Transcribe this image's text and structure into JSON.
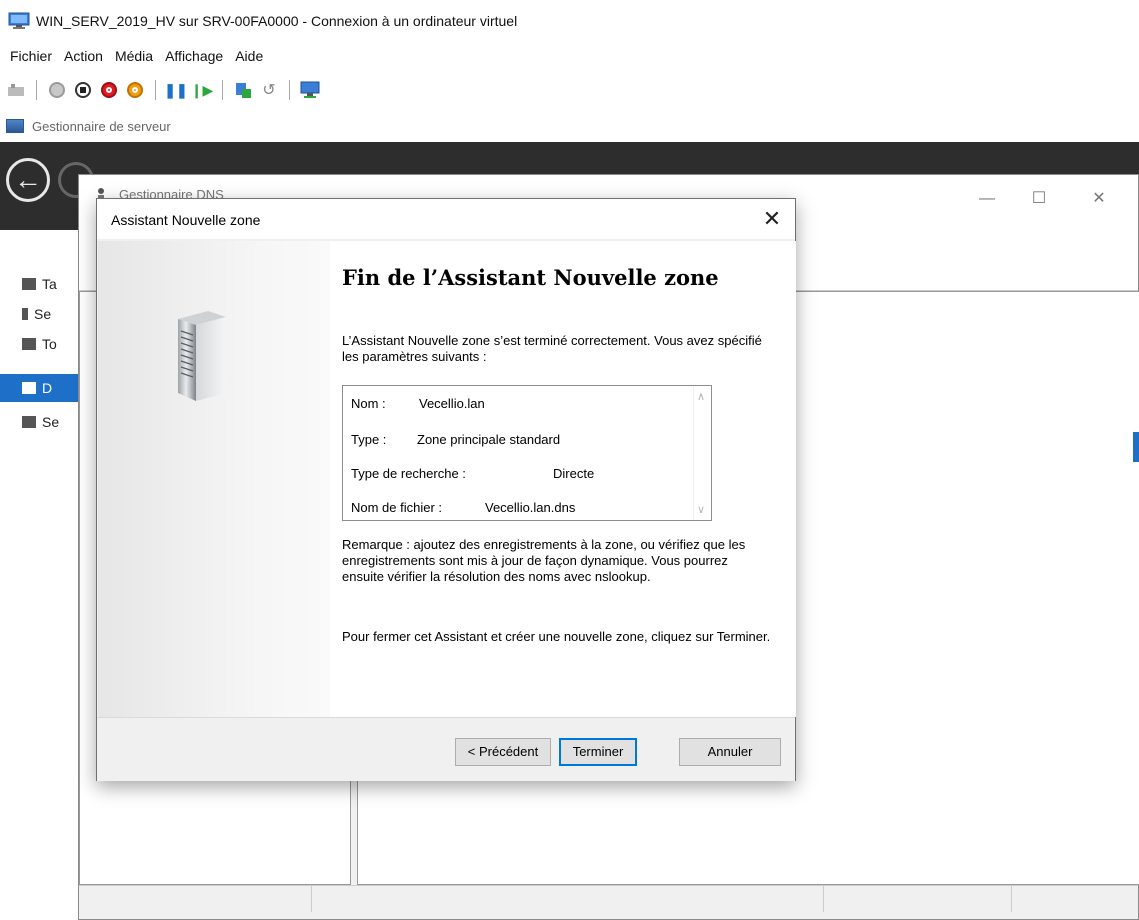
{
  "vm_window": {
    "title": "WIN_SERV_2019_HV sur SRV-00FA0000 - Connexion à un ordinateur virtuel",
    "menu": [
      "Fichier",
      "Action",
      "Média",
      "Affichage",
      "Aide"
    ]
  },
  "server_manager": {
    "tab_label": "Gestionnaire de serveur",
    "sidebar_items": [
      {
        "label": "Ta",
        "icon": "dashboard-icon",
        "active": false
      },
      {
        "label": "Se",
        "icon": "server-icon",
        "active": false
      },
      {
        "label": "To",
        "icon": "all-servers-icon",
        "active": false
      },
      {
        "label": "D",
        "icon": "dns-icon",
        "active": true
      },
      {
        "label": "Se",
        "icon": "file-services-icon",
        "active": false
      }
    ],
    "accent": "#1e6fc8"
  },
  "dns_window": {
    "title": "Gestionnaire DNS"
  },
  "wizard": {
    "title": "Assistant Nouvelle zone",
    "heading": "Fin de l’Assistant Nouvelle zone",
    "intro": "L’Assistant Nouvelle zone s’est terminé correctement. Vous avez spécifié les paramètres suivants :",
    "summary": {
      "name_label": "Nom :",
      "name_value": "Vecellio.lan",
      "type_label": "Type :",
      "type_value": "Zone principale standard",
      "lookup_label": "Type de recherche :",
      "lookup_value": "Directe",
      "file_label": "Nom de fichier :",
      "file_value": "Vecellio.lan.dns"
    },
    "note": "Remarque : ajoutez des enregistrements à la zone, ou vérifiez que les enregistrements sont mis à jour de façon dynamique. Vous pourrez ensuite vérifier la résolution des noms avec nslookup.",
    "closing": "Pour fermer cet Assistant et créer une nouvelle zone, cliquez sur Terminer.",
    "buttons": {
      "back": "< Précédent",
      "finish": "Terminer",
      "cancel": "Annuler"
    }
  }
}
